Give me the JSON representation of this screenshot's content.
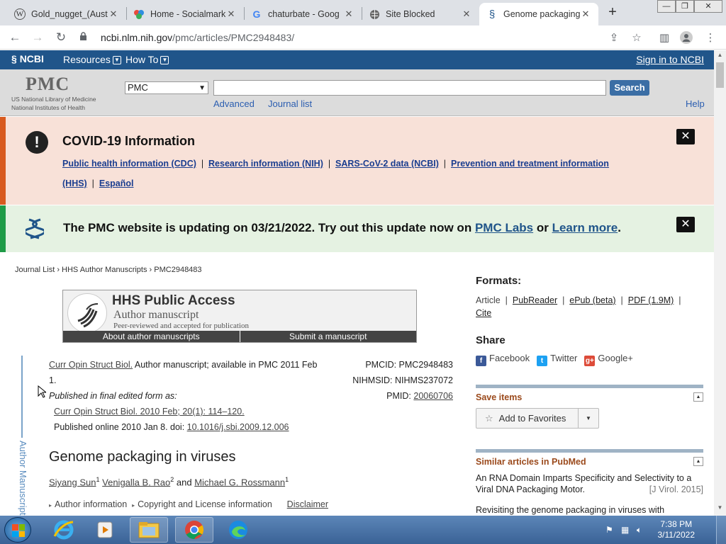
{
  "browser": {
    "tabs": [
      {
        "title": "Gold_nugget_(Aust",
        "icon": "wikipedia-icon"
      },
      {
        "title": "Home - Socialmark",
        "icon": "socialmark-icon"
      },
      {
        "title": "chaturbate - Goog",
        "icon": "google-icon"
      },
      {
        "title": "Site Blocked",
        "icon": "globe-icon"
      },
      {
        "title": "Genome packaging",
        "icon": "ncbi-icon",
        "active": true
      }
    ],
    "url_host": "ncbi.nlm.nih.gov",
    "url_path": "/pmc/articles/PMC2948483/"
  },
  "ncbi": {
    "logo": "NCBI",
    "menu": [
      "Resources",
      "How To"
    ],
    "signin": "Sign in to NCBI"
  },
  "pmc_header": {
    "logo": "PMC",
    "logo_line1": "US National Library of Medicine",
    "logo_line2": "National Institutes of Health",
    "db_selected": "PMC",
    "search_value": "",
    "search_button": "Search",
    "advanced": "Advanced",
    "journal_list": "Journal list",
    "help": "Help"
  },
  "covid": {
    "title": "COVID-19 Information",
    "links": [
      "Public health information (CDC)",
      "Research information (NIH)",
      "SARS-CoV-2 data (NCBI)",
      "Prevention and treatment information (HHS)",
      "Español"
    ]
  },
  "update": {
    "text_before": "The PMC website is updating on 03/21/2022. Try out this update now on",
    "link1": "PMC Labs",
    "mid": "or",
    "link2": "Learn more",
    "end": "."
  },
  "breadcrumb": [
    "Journal List",
    "HHS Author Manuscripts",
    "PMC2948483"
  ],
  "hhs": {
    "title": "HHS Public Access",
    "subtitle": "Author manuscript",
    "tagline": "Peer-reviewed and accepted for publication",
    "about": "About author manuscripts",
    "submit": "Submit a manuscript"
  },
  "citation": {
    "journal": "Curr Opin Struct Biol.",
    "rest": " Author manuscript; available in PMC 2011 Feb 1.",
    "published_label": "Published in final edited form as:",
    "final_ref": "Curr Opin Struct Biol. 2010 Feb; 20(1): 114–120.",
    "online": "Published online 2010 Jan 8. doi: ",
    "doi": "10.1016/j.sbi.2009.12.006",
    "pmcid": "PMCID: PMC2948483",
    "nihmsid": "NIHMSID: NIHMS237072",
    "pmid_label": "PMID: ",
    "pmid": "20060706"
  },
  "side_label": "Author Manuscript",
  "article": {
    "title": "Genome packaging in viruses",
    "authors": [
      {
        "name": "Siyang Sun",
        "sup": "1",
        "after": " "
      },
      {
        "name": "Venigalla B. Rao",
        "sup": "2",
        "after": " and "
      },
      {
        "name": "Michael G. Rossmann",
        "sup": "1",
        "after": ""
      }
    ],
    "author_info": "Author information",
    "copyright": "Copyright and License information",
    "disclaimer": "Disclaimer"
  },
  "right": {
    "formats_title": "Formats:",
    "formats": [
      "Article",
      "PubReader",
      "ePub (beta)",
      "PDF (1.9M)",
      "Cite"
    ],
    "share_title": "Share",
    "share": [
      "Facebook",
      "Twitter",
      "Google+"
    ],
    "save_title": "Save items",
    "add_favorites": "Add to Favorites",
    "similar_title": "Similar articles in PubMed",
    "similar": [
      {
        "title": "An RNA Domain Imparts Specificity and Selectivity to a Viral DNA Packaging Motor.",
        "source": "[J Virol. 2015]"
      },
      {
        "title": "Revisiting the genome packaging in viruses with",
        "source": ""
      }
    ]
  },
  "taskbar": {
    "time": "7:38 PM",
    "date": "3/11/2022"
  },
  "colors": {
    "ncbi_blue": "#20558a",
    "covid_accent": "#d85a1f",
    "update_accent": "#1f9b47",
    "link_blue": "#2a5db0"
  }
}
